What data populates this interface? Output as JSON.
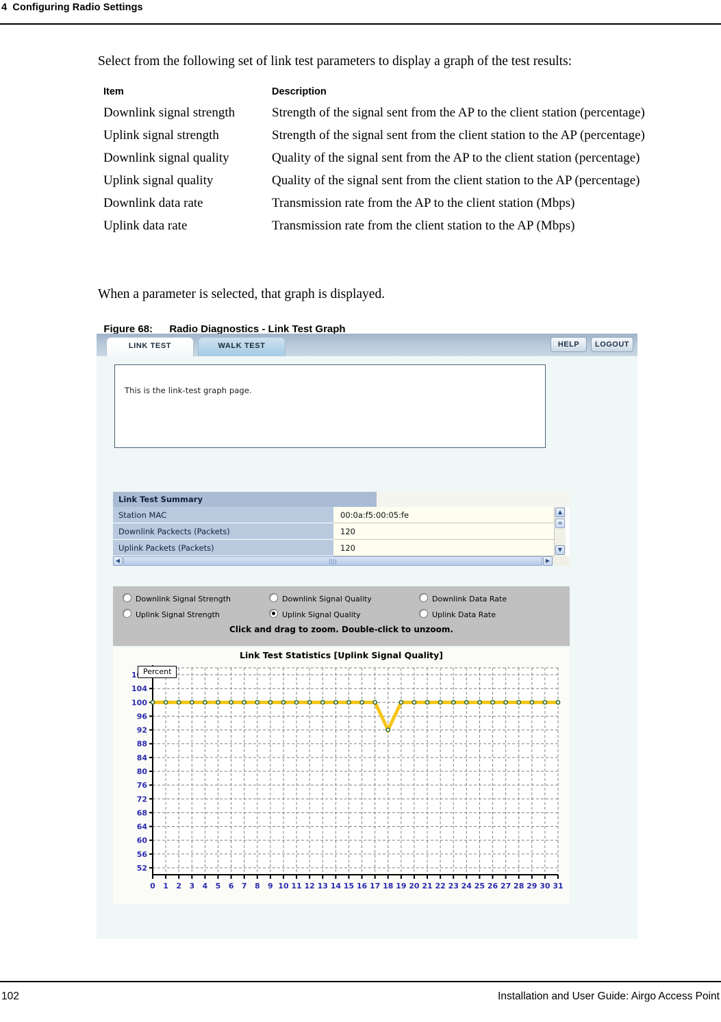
{
  "header": {
    "chapter": "4  Configuring Radio Settings"
  },
  "intro": "Select from the following set of link test parameters to display a graph of the test results:",
  "param_table": {
    "columns": [
      "Item",
      "Description"
    ],
    "rows": [
      [
        "Downlink signal strength",
        "Strength of the signal sent from the AP to the client station (percentage)"
      ],
      [
        "Uplink signal strength",
        "Strength of the signal sent from the client station to the AP (percentage)"
      ],
      [
        "Downlink signal quality",
        "Quality of the signal sent from the AP to the client station (percentage)"
      ],
      [
        "Uplink signal quality",
        "Quality of the signal sent from the client station to the AP (percentage)"
      ],
      [
        "Downlink data rate",
        "Transmission rate from the AP to the client station (Mbps)"
      ],
      [
        "Uplink data rate",
        "Transmission rate from the client station to the AP (Mbps)"
      ]
    ]
  },
  "mid_paragraph": "When a parameter is selected, that graph is displayed.",
  "figure": {
    "number": "Figure 68:",
    "title": "Radio Diagnostics - Link Test Graph"
  },
  "app": {
    "tabs": [
      {
        "label": "LINK TEST",
        "active": true
      },
      {
        "label": "WALK TEST",
        "active": false
      }
    ],
    "buttons": {
      "help": "HELP",
      "logout": "LOGOUT"
    },
    "message": "This is the link-test graph page.",
    "summary": {
      "title": "Link Test Summary",
      "rows": [
        {
          "label": "Station MAC",
          "value": "00:0a:f5:00:05:fe"
        },
        {
          "label": "Downlink Packects (Packets)",
          "value": "120"
        },
        {
          "label": "Uplink Packets (Packets)",
          "value": "120"
        }
      ],
      "scroll_up_icon": "▲",
      "scroll_down_icon": "▼",
      "scroll_left_icon": "◀",
      "scroll_right_icon": "▶",
      "scroll_thumb_icon": "≡"
    },
    "radio_options": [
      {
        "label": "Downlink Signal Strength",
        "checked": false
      },
      {
        "label": "Downlink Signal Quality",
        "checked": false
      },
      {
        "label": "Downlink Data Rate",
        "checked": false
      },
      {
        "label": "Uplink Signal Strength",
        "checked": false
      },
      {
        "label": "Uplink Signal Quality",
        "checked": true
      },
      {
        "label": "Uplink Data Rate",
        "checked": false
      }
    ],
    "zoom_hint": "Click and drag to zoom. Double-click to unzoom.",
    "axis_badge": "Percent"
  },
  "chart_data": {
    "type": "line",
    "title": "Link Test Statistics [Uplink Signal Quality]",
    "xlabel": "",
    "ylabel": "Percent",
    "xlim": [
      0,
      31
    ],
    "ylim": [
      50,
      110
    ],
    "xticks": [
      0,
      1,
      2,
      3,
      4,
      5,
      6,
      7,
      8,
      9,
      10,
      11,
      12,
      13,
      14,
      15,
      16,
      17,
      18,
      19,
      20,
      21,
      22,
      23,
      24,
      25,
      26,
      27,
      28,
      29,
      30,
      31
    ],
    "yticks": [
      52,
      56,
      60,
      64,
      68,
      72,
      76,
      80,
      84,
      88,
      92,
      96,
      100,
      104,
      108
    ],
    "grid": true,
    "legend": false,
    "line_color": "#f5c518",
    "marker_color": "#2f6b2f",
    "x": [
      0,
      1,
      2,
      3,
      4,
      5,
      6,
      7,
      8,
      9,
      10,
      11,
      12,
      13,
      14,
      15,
      16,
      17,
      18,
      19,
      20,
      21,
      22,
      23,
      24,
      25,
      26,
      27,
      28,
      29,
      30,
      31
    ],
    "series": [
      {
        "name": "Uplink Signal Quality",
        "values": [
          100,
          100,
          100,
          100,
          100,
          100,
          100,
          100,
          100,
          100,
          100,
          100,
          100,
          100,
          100,
          100,
          100,
          100,
          92,
          100,
          100,
          100,
          100,
          100,
          100,
          100,
          100,
          100,
          100,
          100,
          100,
          100
        ]
      }
    ]
  },
  "footer": {
    "page_number": "102",
    "guide_title": "Installation and User Guide: Airgo Access Point"
  }
}
